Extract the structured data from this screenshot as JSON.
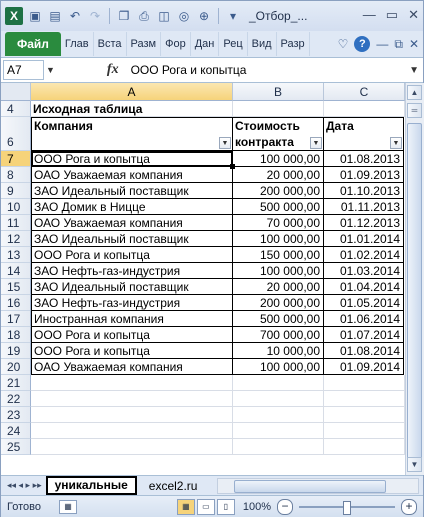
{
  "titlebar": {
    "title": "_Отбор_...",
    "icons": [
      "excel-logo-icon",
      "save-icon",
      "save-as-icon",
      "undo-icon",
      "redo-icon",
      "copy-icon",
      "print-icon",
      "preview-icon",
      "camera-icon",
      "circle-icon",
      "customize-icon"
    ]
  },
  "ribbon": {
    "file_tab": "Файл",
    "tabs": [
      "Глав",
      "Вста",
      "Разм",
      "Фор",
      "Дан",
      "Рец",
      "Вид",
      "Разр"
    ],
    "help": "?"
  },
  "formula_bar": {
    "name_box": "A7",
    "fx": "fx",
    "value": "ООО Рога и копытца"
  },
  "columns": [
    {
      "label": "A",
      "selected": true
    },
    {
      "label": "B",
      "selected": false
    },
    {
      "label": "C",
      "selected": false
    }
  ],
  "sheet": {
    "title_row": {
      "num": "4",
      "text": "Исходная таблица"
    },
    "header": {
      "num": "6",
      "company": "Компания",
      "cost_line1": "Стоимость",
      "cost_line2": "контракта",
      "date": "Дата"
    },
    "rows": [
      {
        "num": "7",
        "company": "ООО Рога и копытца",
        "cost": "100 000,00",
        "date": "01.08.2013",
        "active": true
      },
      {
        "num": "8",
        "company": "ОАО Уважаемая компания",
        "cost": "20 000,00",
        "date": "01.09.2013"
      },
      {
        "num": "9",
        "company": "ЗАО Идеальный поставщик",
        "cost": "200 000,00",
        "date": "01.10.2013"
      },
      {
        "num": "10",
        "company": "ЗАО Домик в Ницце",
        "cost": "500 000,00",
        "date": "01.11.2013"
      },
      {
        "num": "11",
        "company": "ОАО Уважаемая компания",
        "cost": "70 000,00",
        "date": "01.12.2013"
      },
      {
        "num": "12",
        "company": "ЗАО Идеальный поставщик",
        "cost": "100 000,00",
        "date": "01.01.2014"
      },
      {
        "num": "13",
        "company": "ООО Рога и копытца",
        "cost": "150 000,00",
        "date": "01.02.2014"
      },
      {
        "num": "14",
        "company": "ЗАО Нефть-газ-индустрия",
        "cost": "100 000,00",
        "date": "01.03.2014"
      },
      {
        "num": "15",
        "company": "ЗАО Идеальный поставщик",
        "cost": "20 000,00",
        "date": "01.04.2014"
      },
      {
        "num": "16",
        "company": "ЗАО Нефть-газ-индустрия",
        "cost": "200 000,00",
        "date": "01.05.2014"
      },
      {
        "num": "17",
        "company": "Иностранная компания",
        "cost": "500 000,00",
        "date": "01.06.2014"
      },
      {
        "num": "18",
        "company": "ООО Рога и копытца",
        "cost": "700 000,00",
        "date": "01.07.2014"
      },
      {
        "num": "19",
        "company": "ООО Рога и копытца",
        "cost": "10 000,00",
        "date": "01.08.2014"
      },
      {
        "num": "20",
        "company": "ОАО Уважаемая компания",
        "cost": "100 000,00",
        "date": "01.09.2014"
      }
    ],
    "empty_rows": [
      "21",
      "22",
      "23",
      "24",
      "25"
    ]
  },
  "sheet_tabs": {
    "nav": "◂◂ ◂ ▸ ▸▸",
    "tabs": [
      "уникальные",
      "excel2.ru"
    ],
    "active": 0
  },
  "statusbar": {
    "ready": "Готово",
    "zoom": "100%",
    "minus": "−",
    "plus": "+"
  }
}
